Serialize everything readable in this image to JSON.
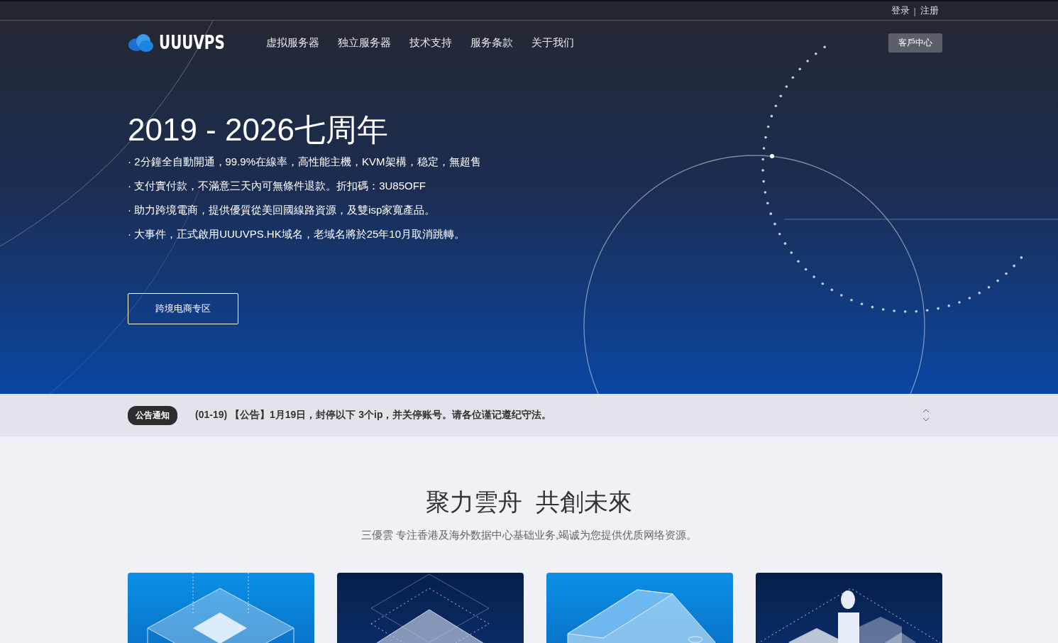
{
  "top_bar": {
    "links": [
      "登录",
      "注册"
    ],
    "separator": "|"
  },
  "header": {
    "logo": "UUUVPS",
    "nav": [
      {
        "label": "虚拟服务器"
      },
      {
        "label": "独立服务器"
      },
      {
        "label": "技术支持"
      },
      {
        "label": "服务条款"
      },
      {
        "label": "关于我们"
      }
    ],
    "client_button": "客戶中心"
  },
  "hero": {
    "title": "2019 - 2026七周年",
    "points": [
      "· 2分鐘全自動開通，99.9%在線率，高性能主機，KVM架構，稳定，無超售",
      "· 支付實付款，不滿意三天內可無條件退款。折扣碼：3U85OFF",
      "· 助力跨境電商，提供優質從美回國線路資源，及雙isp家寬產品。",
      "· 大事件，正式啟用UUUVPS.HK域名，老域名將於25年10月取消跳轉。"
    ],
    "button": "跨境电商专区"
  },
  "notice": {
    "badge": "公告通知",
    "text": "(01-19) 【公告】1月19日，封停以下 3个ip，并关停账号。请各位谨记遵纪守法。"
  },
  "intro": {
    "title": "聚力雲舟  共創未來",
    "subtitle": "三優雲 专注香港及海外数据中心基础业务,竭诚为您提供优质网络资源。"
  },
  "cards": [
    {
      "kind": "cube"
    },
    {
      "kind": "layers"
    },
    {
      "kind": "building"
    },
    {
      "kind": "person"
    }
  ]
}
